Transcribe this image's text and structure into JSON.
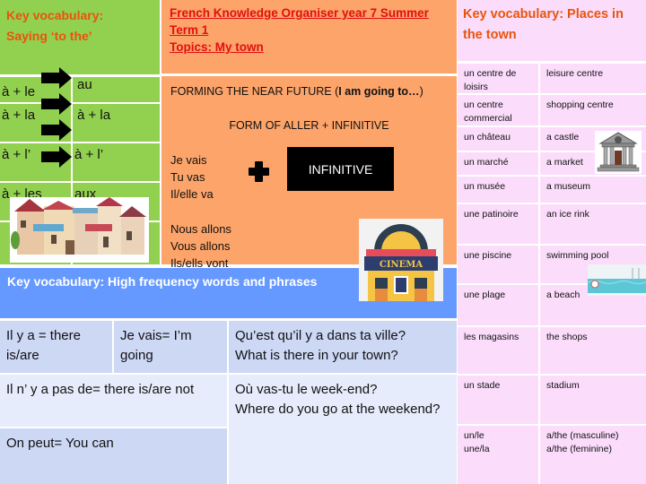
{
  "left_panel": {
    "title_line1": "Key vocabulary:",
    "title_line2": "Saying ‘to the’",
    "rows": [
      {
        "from": "à + le",
        "to": "au"
      },
      {
        "from": "à + la",
        "to": "à + la"
      },
      {
        "from": "à + l’",
        "to": "à + l’"
      },
      {
        "from": "à + les",
        "to": "aux"
      }
    ],
    "image": "town-houses-illustration"
  },
  "center_panel": {
    "title_line1": "French Knowledge Organiser year 7 Summer",
    "title_line2": "Term 1",
    "title_line3": "Topics: My town",
    "near_future_prefix": "FORMING THE NEAR FUTURE (",
    "near_future_bold": "I am going to…",
    "near_future_suffix": ")",
    "formula": "FORM OF ALLER + INFINITIVE",
    "conjugations_singular": [
      "Je vais",
      "Tu vas",
      "Il/elle va"
    ],
    "conjugations_plural": [
      "Nous allons",
      "Vous allons",
      "Ils/ells vont"
    ],
    "infinitive_label": "INFINITIVE",
    "plus_icon": "plus-icon",
    "image": "cinema-illustration",
    "image_label": "CINEMA"
  },
  "bottom_panel": {
    "title": "Key vocabulary: High frequency words and phrases",
    "cells": {
      "il_y_a": "Il y a = there is/are",
      "je_vais": "Je vais= I’m going",
      "question1_fr": "Qu’est qu’il y a dans ta ville?",
      "question1_en": "What is there in your town?",
      "il_ny_a_pas": "Il n’ y a pas de= there is/are not",
      "question2_fr": "Où vas-tu le week-end?",
      "question2_en": "Where do you go at the weekend?",
      "on_peut": "On peut= You can"
    }
  },
  "right_panel": {
    "title_line1": "Key vocabulary: Places in",
    "title_line2": "the town",
    "rows": [
      {
        "fr": "un centre de loisirs",
        "en": "leisure centre"
      },
      {
        "fr": "un centre commercial",
        "en": "shopping centre"
      },
      {
        "fr": "un château",
        "en": "a castle"
      },
      {
        "fr": "un marché",
        "en": "a market"
      },
      {
        "fr": "un musée",
        "en": "a museum"
      },
      {
        "fr": "une patinoire",
        "en": "an ice rink"
      },
      {
        "fr": "une piscine",
        "en": "swimming pool"
      },
      {
        "fr": "une plage",
        "en": "a beach"
      },
      {
        "fr": "les magasins",
        "en": "the shops"
      },
      {
        "fr": "un stade",
        "en": "stadium"
      },
      {
        "fr": "un/le\nune/la",
        "en": "a/the (masculine)\na/the (feminine)"
      }
    ],
    "images": [
      "museum-building-illustration",
      "swimming-pool-illustration"
    ]
  },
  "colors": {
    "green": "#92d050",
    "orange": "#fca46a",
    "blue": "#6699ff",
    "pink": "#fbdcfb",
    "title_orange": "#e8540c",
    "title_red": "#e20f0f"
  }
}
